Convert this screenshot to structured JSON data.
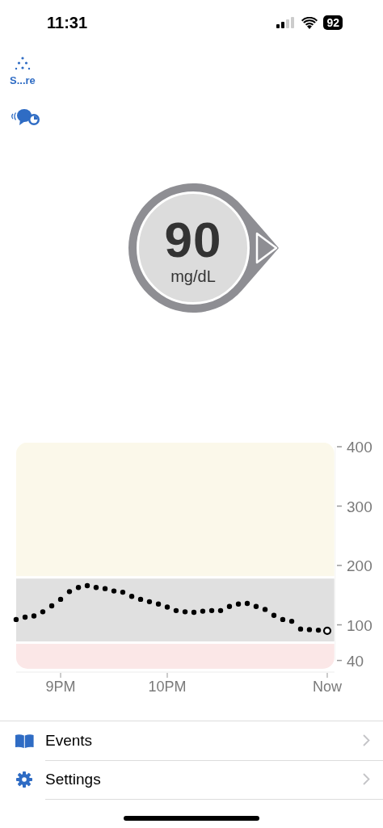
{
  "status_bar": {
    "time": "11:31",
    "battery": "92"
  },
  "shortcuts": [
    {
      "kind": "sensor",
      "label": "S...re"
    },
    {
      "kind": "alerts"
    }
  ],
  "reading": {
    "value": "90",
    "unit": "mg/dL"
  },
  "chart": {
    "chart_data": {
      "type": "scatter",
      "xlim": [
        8.583,
        11.567
      ],
      "ylim": [
        40,
        400
      ],
      "yticks": [
        40,
        100,
        200,
        300,
        400
      ],
      "xticks": [
        {
          "value": 9,
          "label": "9PM"
        },
        {
          "value": 10,
          "label": "10PM"
        },
        {
          "value": 11.5,
          "label": "Now"
        }
      ],
      "x": [
        8.583,
        8.667,
        8.75,
        8.833,
        8.917,
        9,
        9.083,
        9.167,
        9.25,
        9.333,
        9.417,
        9.5,
        9.583,
        9.667,
        9.75,
        9.833,
        9.917,
        10,
        10.083,
        10.167,
        10.25,
        10.333,
        10.417,
        10.5,
        10.583,
        10.667,
        10.75,
        10.833,
        10.917,
        11,
        11.083,
        11.167,
        11.25,
        11.333,
        11.417,
        11.5
      ],
      "series": [
        {
          "color": "#000000",
          "values": [
            109,
            113,
            115,
            122,
            132,
            143,
            156,
            163,
            166,
            163,
            161,
            157,
            155,
            148,
            143,
            139,
            135,
            130,
            124,
            122,
            121,
            123,
            124,
            124,
            131,
            135,
            136,
            131,
            126,
            116,
            109,
            106,
            93,
            92,
            91,
            90
          ]
        }
      ]
    }
  },
  "menu": [
    {
      "kind": "events",
      "label": "Events"
    },
    {
      "kind": "settings",
      "label": "Settings"
    }
  ]
}
